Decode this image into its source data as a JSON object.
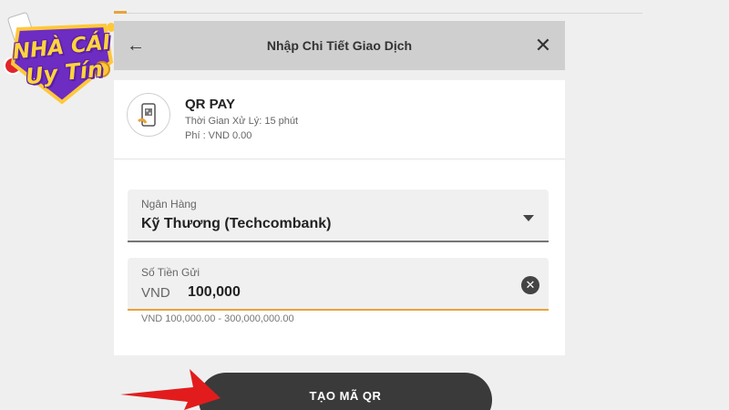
{
  "logo": {
    "line1": "NHÀ CÁI",
    "line2": "Uy Tín"
  },
  "header": {
    "title": "Nhập Chi Tiết Giao Dịch",
    "back_icon": "←",
    "close_icon": "✕"
  },
  "method": {
    "name": "QR PAY",
    "processing": "Thời Gian Xử Lý: 15 phút",
    "fee": "Phí : VND 0.00"
  },
  "bank": {
    "label": "Ngân Hàng",
    "value": "Kỹ Thương (Techcombank)"
  },
  "amount": {
    "label": "Số Tiền Gửi",
    "currency": "VND",
    "value": "100,000",
    "clear_icon": "✕",
    "range_hint": "VND 100,000.00 - 300,000,000.00"
  },
  "submit": {
    "label": "TẠO MÃ QR"
  },
  "colors": {
    "accent": "#e8a33c",
    "header_bg": "#cfcfcf",
    "button_bg": "#3a3a3a",
    "arrow": "#e21c1c"
  },
  "icons": {
    "phone": "phone-qr-icon",
    "arrow": "red-pointer-arrow"
  }
}
